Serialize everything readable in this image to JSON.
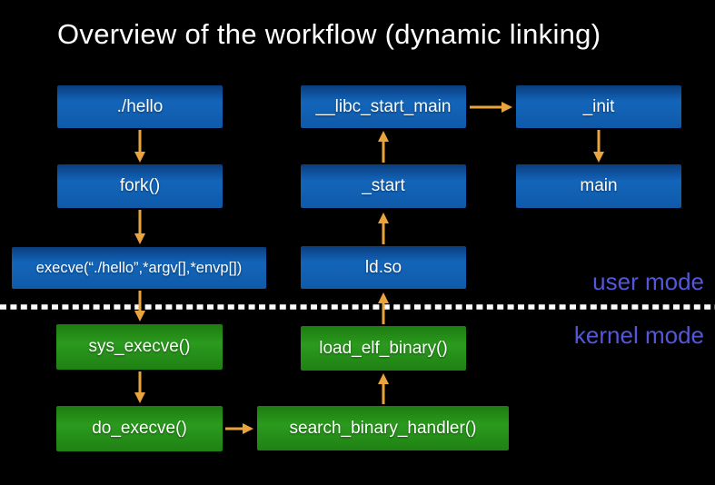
{
  "title": "Overview of the workflow (dynamic linking)",
  "regions": {
    "user_mode_label": "user mode",
    "kernel_mode_label": "kernel mode"
  },
  "nodes": {
    "hello": {
      "label": "./hello",
      "mode": "user"
    },
    "fork": {
      "label": "fork()",
      "mode": "user"
    },
    "execve": {
      "label": "execve(“./hello”,*argv[],*envp[])",
      "mode": "user"
    },
    "libc_start_main": {
      "label": "__libc_start_main",
      "mode": "user"
    },
    "start": {
      "label": "_start",
      "mode": "user"
    },
    "ldso": {
      "label": "ld.so",
      "mode": "user"
    },
    "init": {
      "label": "_init",
      "mode": "user"
    },
    "main": {
      "label": "main",
      "mode": "user"
    },
    "sys_execve": {
      "label": "sys_execve()",
      "mode": "kernel"
    },
    "do_execve": {
      "label": "do_execve()",
      "mode": "kernel"
    },
    "load_elf_binary": {
      "label": "load_elf_binary()",
      "mode": "kernel"
    },
    "search_binary_handler": {
      "label": "search_binary_handler()",
      "mode": "kernel"
    }
  },
  "edges": [
    {
      "from": "hello",
      "to": "fork"
    },
    {
      "from": "fork",
      "to": "execve"
    },
    {
      "from": "execve",
      "to": "sys_execve"
    },
    {
      "from": "sys_execve",
      "to": "do_execve"
    },
    {
      "from": "do_execve",
      "to": "search_binary_handler"
    },
    {
      "from": "search_binary_handler",
      "to": "load_elf_binary"
    },
    {
      "from": "load_elf_binary",
      "to": "ldso"
    },
    {
      "from": "ldso",
      "to": "start"
    },
    {
      "from": "start",
      "to": "libc_start_main"
    },
    {
      "from": "libc_start_main",
      "to": "init"
    },
    {
      "from": "init",
      "to": "main"
    }
  ],
  "colors": {
    "background": "#000000",
    "user_box_blue": "#1262B6",
    "kernel_box_green": "#28991B",
    "arrow_orange": "#E9A43E",
    "mode_label_purple": "#5457D8",
    "divider_white": "#FFFFFF",
    "title_text": "#FFFFFF",
    "node_text": "#FFFFFF"
  }
}
